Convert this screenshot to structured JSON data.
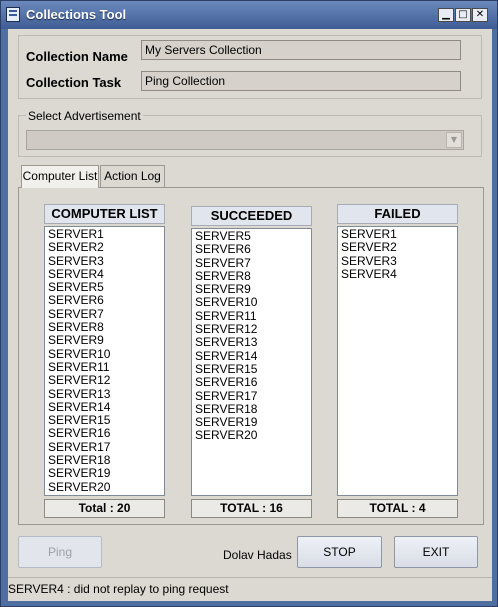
{
  "window": {
    "title": "Collections Tool",
    "controls": {
      "minimize": "▁",
      "maximize": "□",
      "close": "✕"
    }
  },
  "collection": {
    "name_label": "Collection Name",
    "name_value": "My Servers Collection",
    "task_label": "Collection Task",
    "task_value": "Ping Collection"
  },
  "advertisement": {
    "label": "Select Advertisement",
    "selected": ""
  },
  "tabs": [
    {
      "label": "Computer List",
      "active": true
    },
    {
      "label": "Action Log",
      "active": false
    }
  ],
  "computer_list": {
    "header": "COMPUTER LIST",
    "items": [
      "SERVER1",
      "SERVER2",
      "SERVER3",
      "SERVER4",
      "SERVER5",
      "SERVER6",
      "SERVER7",
      "SERVER8",
      "SERVER9",
      "SERVER10",
      "SERVER11",
      "SERVER12",
      "SERVER13",
      "SERVER14",
      "SERVER15",
      "SERVER16",
      "SERVER17",
      "SERVER18",
      "SERVER19",
      "SERVER20"
    ],
    "total": "Total : 20"
  },
  "succeeded": {
    "header": "SUCCEEDED",
    "items": [
      "SERVER5",
      "SERVER6",
      "SERVER7",
      "SERVER8",
      "SERVER9",
      "SERVER10",
      "SERVER11",
      "SERVER12",
      "SERVER13",
      "SERVER14",
      "SERVER15",
      "SERVER16",
      "SERVER17",
      "SERVER18",
      "SERVER19",
      "SERVER20"
    ],
    "total": "TOTAL : 16"
  },
  "failed": {
    "header": "FAILED",
    "items": [
      "SERVER1",
      "SERVER2",
      "SERVER3",
      "SERVER4"
    ],
    "total": "TOTAL : 4"
  },
  "buttons": {
    "ping": "Ping",
    "author": "Dolav Hadas",
    "stop": "STOP",
    "exit": "EXIT"
  },
  "status": {
    "text": "SERVER4 : did not replay to ping request"
  },
  "colors": {
    "title_bar": "#4f6fa3",
    "client_bg": "#dcd8d2",
    "list_bg": "#ffffff"
  }
}
